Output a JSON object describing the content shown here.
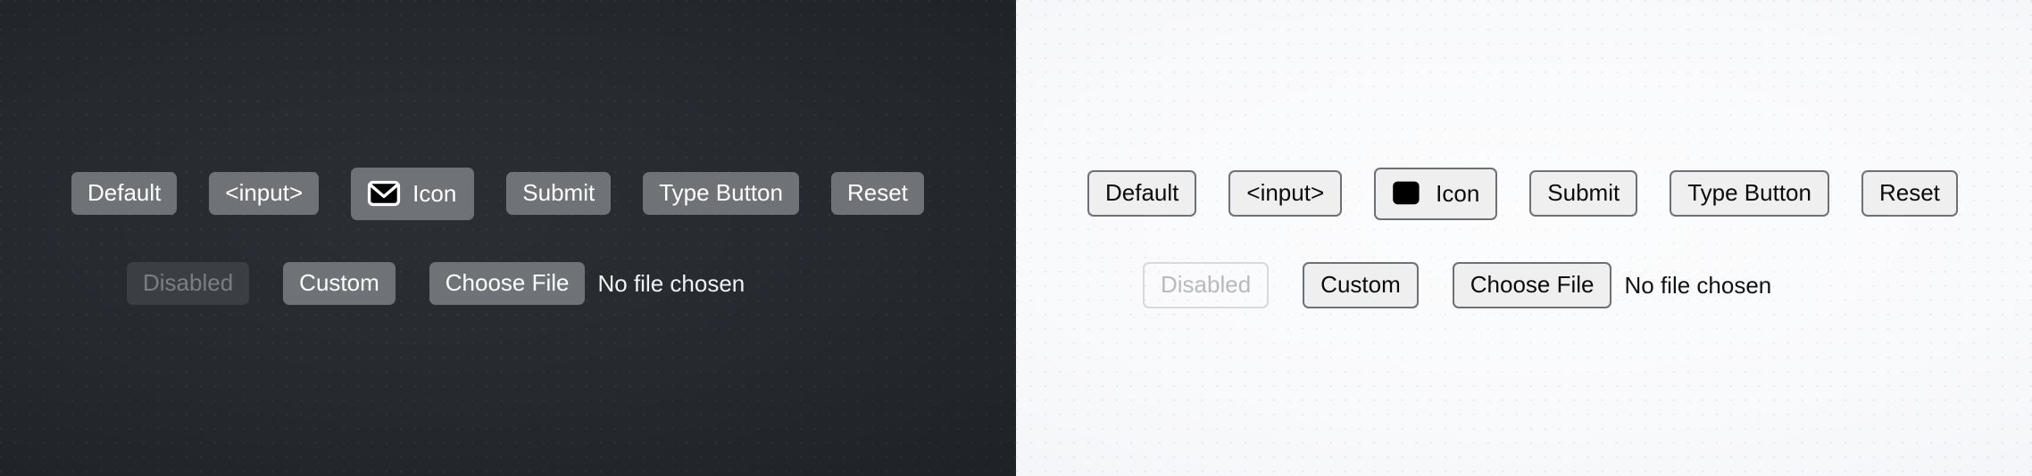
{
  "panels": [
    {
      "theme": "dark",
      "background_color": "#24282d",
      "button_fill": "#6f7276",
      "button_text_color": "#ffffff",
      "disabled_fill": "#3b3e43",
      "disabled_text_color": "#7b7f85",
      "row1": {
        "default_label": "Default",
        "input_label": "<input>",
        "icon_label": "Icon",
        "icon_name": "envelope-icon",
        "submit_label": "Submit",
        "type_button_label": "Type Button",
        "reset_label": "Reset"
      },
      "row2": {
        "disabled_label": "Disabled",
        "custom_label": "Custom",
        "choose_file_label": "Choose File",
        "file_status": "No file chosen"
      }
    },
    {
      "theme": "light",
      "background_color": "#f8f9fb",
      "button_fill": "#efefef",
      "button_text_color": "#0b0b0b",
      "button_border_color": "#6d7074",
      "disabled_text_color": "#b6b9bd",
      "disabled_border_color": "#d6d9dd",
      "row1": {
        "default_label": "Default",
        "input_label": "<input>",
        "icon_label": "Icon",
        "icon_name": "filled-square-icon",
        "submit_label": "Submit",
        "type_button_label": "Type Button",
        "reset_label": "Reset"
      },
      "row2": {
        "disabled_label": "Disabled",
        "custom_label": "Custom",
        "choose_file_label": "Choose File",
        "file_status": "No file chosen"
      }
    }
  ]
}
